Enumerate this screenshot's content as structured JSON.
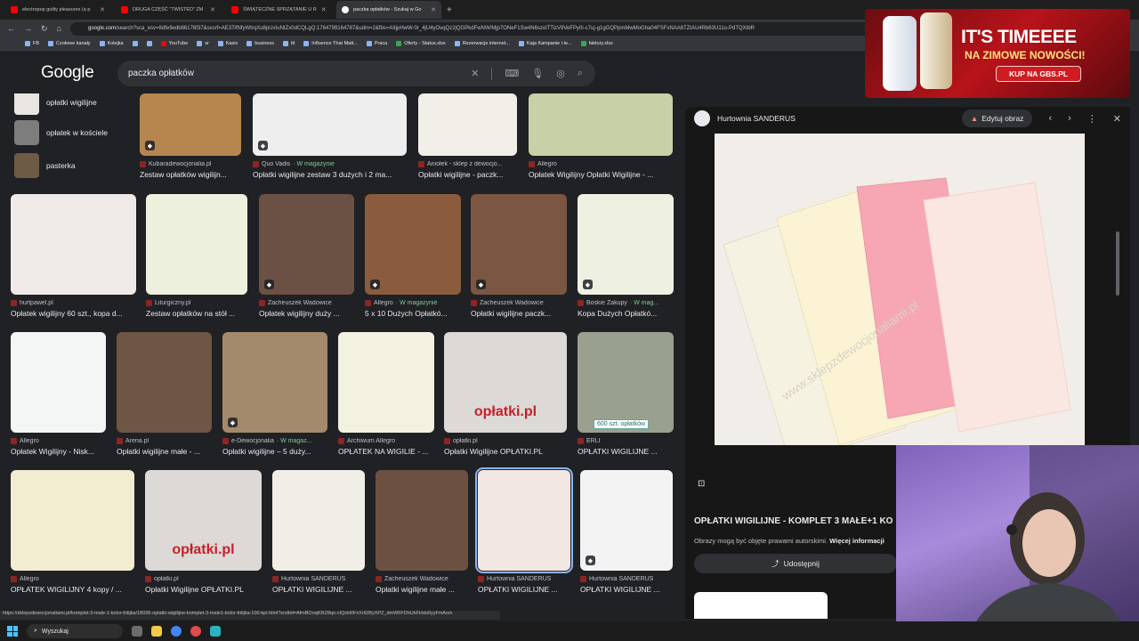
{
  "tabs": [
    {
      "label": "electropop guilty pleasures (a p",
      "active": false
    },
    {
      "label": "DRUGA CZĘŚĆ \"TWISTED\" ZM",
      "active": false
    },
    {
      "label": "ŚWIĄTECZNE SPRZĄTANIE U R",
      "active": false
    },
    {
      "label": "paczka opłatków - Szukaj w Go",
      "active": true
    }
  ],
  "address": {
    "host": "google.com",
    "path": "/search?sca_esv=8dfe9edb86176f37&sxsrf=AE3TifNfyWtrqXu8pUxIuNtZx0dCQLgQ:1764799164787&udm=2&fbs=AIIjpHwW-0r_4jU4yOvqQz2jQGPkdFwNW/Mjp7ONeF1Sw4N6szolTTizV9VeFPy0i-c7uj-g1gGQPpmMwMoGha04FSFsNAA6TZtAU4Rb63U11o-PdTQXtbR"
  },
  "bookmarks": [
    "FB",
    "Czołowe kanały",
    "Kolejka",
    "",
    "",
    "YouTube",
    "sr",
    "Kasix",
    "business",
    "itt",
    "Influence That Matt...",
    "Praca",
    "Oferty - Status.xlsx",
    "Rezerwacje internet...",
    "Kaja Kampanie i te...",
    "faktury.xlsx"
  ],
  "header": {
    "logo": "Google",
    "query": "paczka opłatków"
  },
  "related": [
    "opłatki wigilijne",
    "opłatek w kościele",
    "pasterka"
  ],
  "rows": [
    [
      {
        "source": "Kubaradewocjonalia.pl",
        "magazine": "",
        "title": "Zestaw opłatków wigilijn...",
        "color": "#b7864f"
      },
      {
        "source": "Quo Vadis",
        "magazine": "· W magazynie",
        "title": "Opłatki wigilijne zestaw 3 dużych i 2 ma...",
        "color": "#eeeeee"
      },
      {
        "source": "Aniołek - sklep z dewocjo...",
        "magazine": "",
        "title": "Opłatki wigilijne - paczk...",
        "color": "#f2efe8"
      },
      {
        "source": "Allegro",
        "magazine": "",
        "title": "Opłatek Wigilijny Opłatki Wigilijne - ...",
        "color": "#c7d0a6"
      }
    ],
    [
      {
        "source": "hurtpawel.pl",
        "magazine": "",
        "title": "Opłatek wigilijny 60 szt., kopa d...",
        "color": "#efe9e8"
      },
      {
        "source": "Liturgiczny.pl",
        "magazine": "",
        "title": "Zestaw opłatków na stół ...",
        "color": "#eef0de"
      },
      {
        "source": "Zacheuszek Wadowice",
        "magazine": "",
        "title": "Opłatek wigilijny duży ...",
        "color": "#6b5144"
      },
      {
        "source": "Allegro",
        "magazine": "· W magazynie",
        "title": "5 x 10 Dużych Opłatkó...",
        "color": "#8a5b3c"
      },
      {
        "source": "Zacheuszek Wadowice",
        "magazine": "",
        "title": "Opłatki wigilijne paczk...",
        "color": "#7b5642"
      },
      {
        "source": "Boskie Zakupy",
        "magazine": "· W mag...",
        "title": "Kopa Dużych Opłatkó...",
        "color": "#eef0e2"
      }
    ],
    [
      {
        "source": "Allegro",
        "magazine": "",
        "title": "Opłatek Wigilijny - Nisk...",
        "color": "#f4f6f6"
      },
      {
        "source": "Arena.pl",
        "magazine": "",
        "title": "Opłatki wigilijne małe - ...",
        "color": "#6f5543"
      },
      {
        "source": "e-Dewocjonalia",
        "magazine": "· W magaz...",
        "title": "Opłatki wigilijne – 5 duży...",
        "color": "#a38a6c"
      },
      {
        "source": "Archiwum Allegro",
        "magazine": "",
        "title": "OPŁATEK NA WIGILIE - ...",
        "color": "#f3f1e0"
      },
      {
        "source": "opłatki.pl",
        "magazine": "",
        "title": "Opłatki Wigilijne OPŁATKI.PL",
        "color": "#dcd9d6"
      },
      {
        "source": "ERLI",
        "magazine": "",
        "title": "OPŁATKI WIGILIJNE ...",
        "color": "#9aa08f"
      }
    ],
    [
      {
        "source": "Allegro",
        "magazine": "",
        "title": "OPŁATEK WIGILIJNY 4 kopy / ...",
        "color": "#f2ecd0"
      },
      {
        "source": "opłatki.pl",
        "magazine": "",
        "title": "Opłatki Wigilijne OPŁATKI.PL",
        "color": "#dcd9d6"
      },
      {
        "source": "Hurtownia SANDERUS",
        "magazine": "",
        "title": "OPŁATKI WIGILIJNE ...",
        "color": "#f1eee8"
      },
      {
        "source": "Zacheuszek Wadowice",
        "magazine": "",
        "title": "Opłatki wigilijne małe ...",
        "color": "#6c5143"
      },
      {
        "source": "Hurtownia SANDERUS",
        "magazine": "",
        "title": "OPŁATKI WIGILIJNE ...",
        "color": "#f2e7e2"
      },
      {
        "source": "Hurtownia SANDERUS",
        "magazine": "",
        "title": "OPŁATKI WIGILIJNE ...",
        "color": "#f3f3f3"
      }
    ]
  ],
  "overlay_texts": {
    "oplatki": "opłatki.pl",
    "count": "600 szt. opłatków"
  },
  "panel": {
    "site": "Hurtownia SANDERUS",
    "edit_label": "Edytuj obraz",
    "title": "OPŁATKI WIGILIJNE - KOMPLET 3 MAŁE+1 KO",
    "note": "Obrazy mogą być objęte prawami autorskimi.",
    "note_link": "Więcej informacji",
    "share_label": "Udostępnij",
    "watermark": "www.sklepzdewocjonaliami.pl"
  },
  "ad": {
    "headline": "IT'S TIMEEEE",
    "subline": "NA ZIMOWE NOWOŚCI!",
    "cta": "KUP NA GBS.PL"
  },
  "status_url": "https://sklepzdewocjonaliami.pl/komplet-3-male-1-kolor-folijka/18036-oplatki-wigilijne-komplet-3-male1-kolor-folijka-100-kpl.html?srsltid=AfmBOoqKRZ8qo-cIQzkRFxXrIi2ByXPZ_dmW5FDhUkFHdo0yyFmAsm",
  "taskbar": {
    "search": "Wyszukaj"
  },
  "colors": {
    "accent": "#8ab4f8",
    "magazine_green": "#81c995",
    "background": "#202124"
  }
}
